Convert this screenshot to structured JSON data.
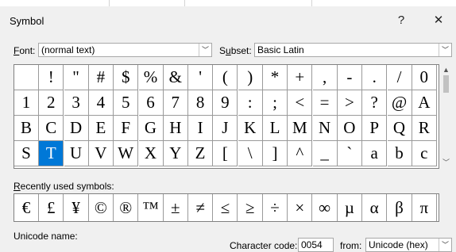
{
  "dialog": {
    "title": "Symbol",
    "help_label": "?",
    "close_label": "✕"
  },
  "font": {
    "label_accel": "F",
    "label_rest": "ont:",
    "value": "(normal text)"
  },
  "subset": {
    "label_pre": "S",
    "label_accel": "u",
    "label_rest": "bset:",
    "value": "Basic Latin"
  },
  "grid": {
    "rows": [
      [
        "",
        "!",
        "\"",
        "#",
        "$",
        "%",
        "&",
        "'",
        "(",
        ")",
        "*",
        "+",
        ",",
        "-",
        ".",
        "/",
        "0"
      ],
      [
        "1",
        "2",
        "3",
        "4",
        "5",
        "6",
        "7",
        "8",
        "9",
        ":",
        ";",
        "<",
        "=",
        ">",
        "?",
        "@",
        "A"
      ],
      [
        "B",
        "C",
        "D",
        "E",
        "F",
        "G",
        "H",
        "I",
        "J",
        "K",
        "L",
        "M",
        "N",
        "O",
        "P",
        "Q",
        "R"
      ],
      [
        "S",
        "T",
        "U",
        "V",
        "W",
        "X",
        "Y",
        "Z",
        "[",
        "\\",
        "]",
        "^",
        "_",
        "`",
        "a",
        "b",
        "c"
      ]
    ],
    "selected": "T"
  },
  "recent": {
    "label_accel": "R",
    "label_rest": "ecently used symbols:",
    "symbols": [
      "€",
      "£",
      "¥",
      "©",
      "®",
      "™",
      "±",
      "≠",
      "≤",
      "≥",
      "÷",
      "×",
      "∞",
      "µ",
      "α",
      "β",
      "π"
    ]
  },
  "unicode_name_label": "Unicode name:",
  "character_code": {
    "label": "Character code:",
    "value": "0054"
  },
  "from": {
    "label": "from:",
    "value": "Unicode (hex)"
  }
}
